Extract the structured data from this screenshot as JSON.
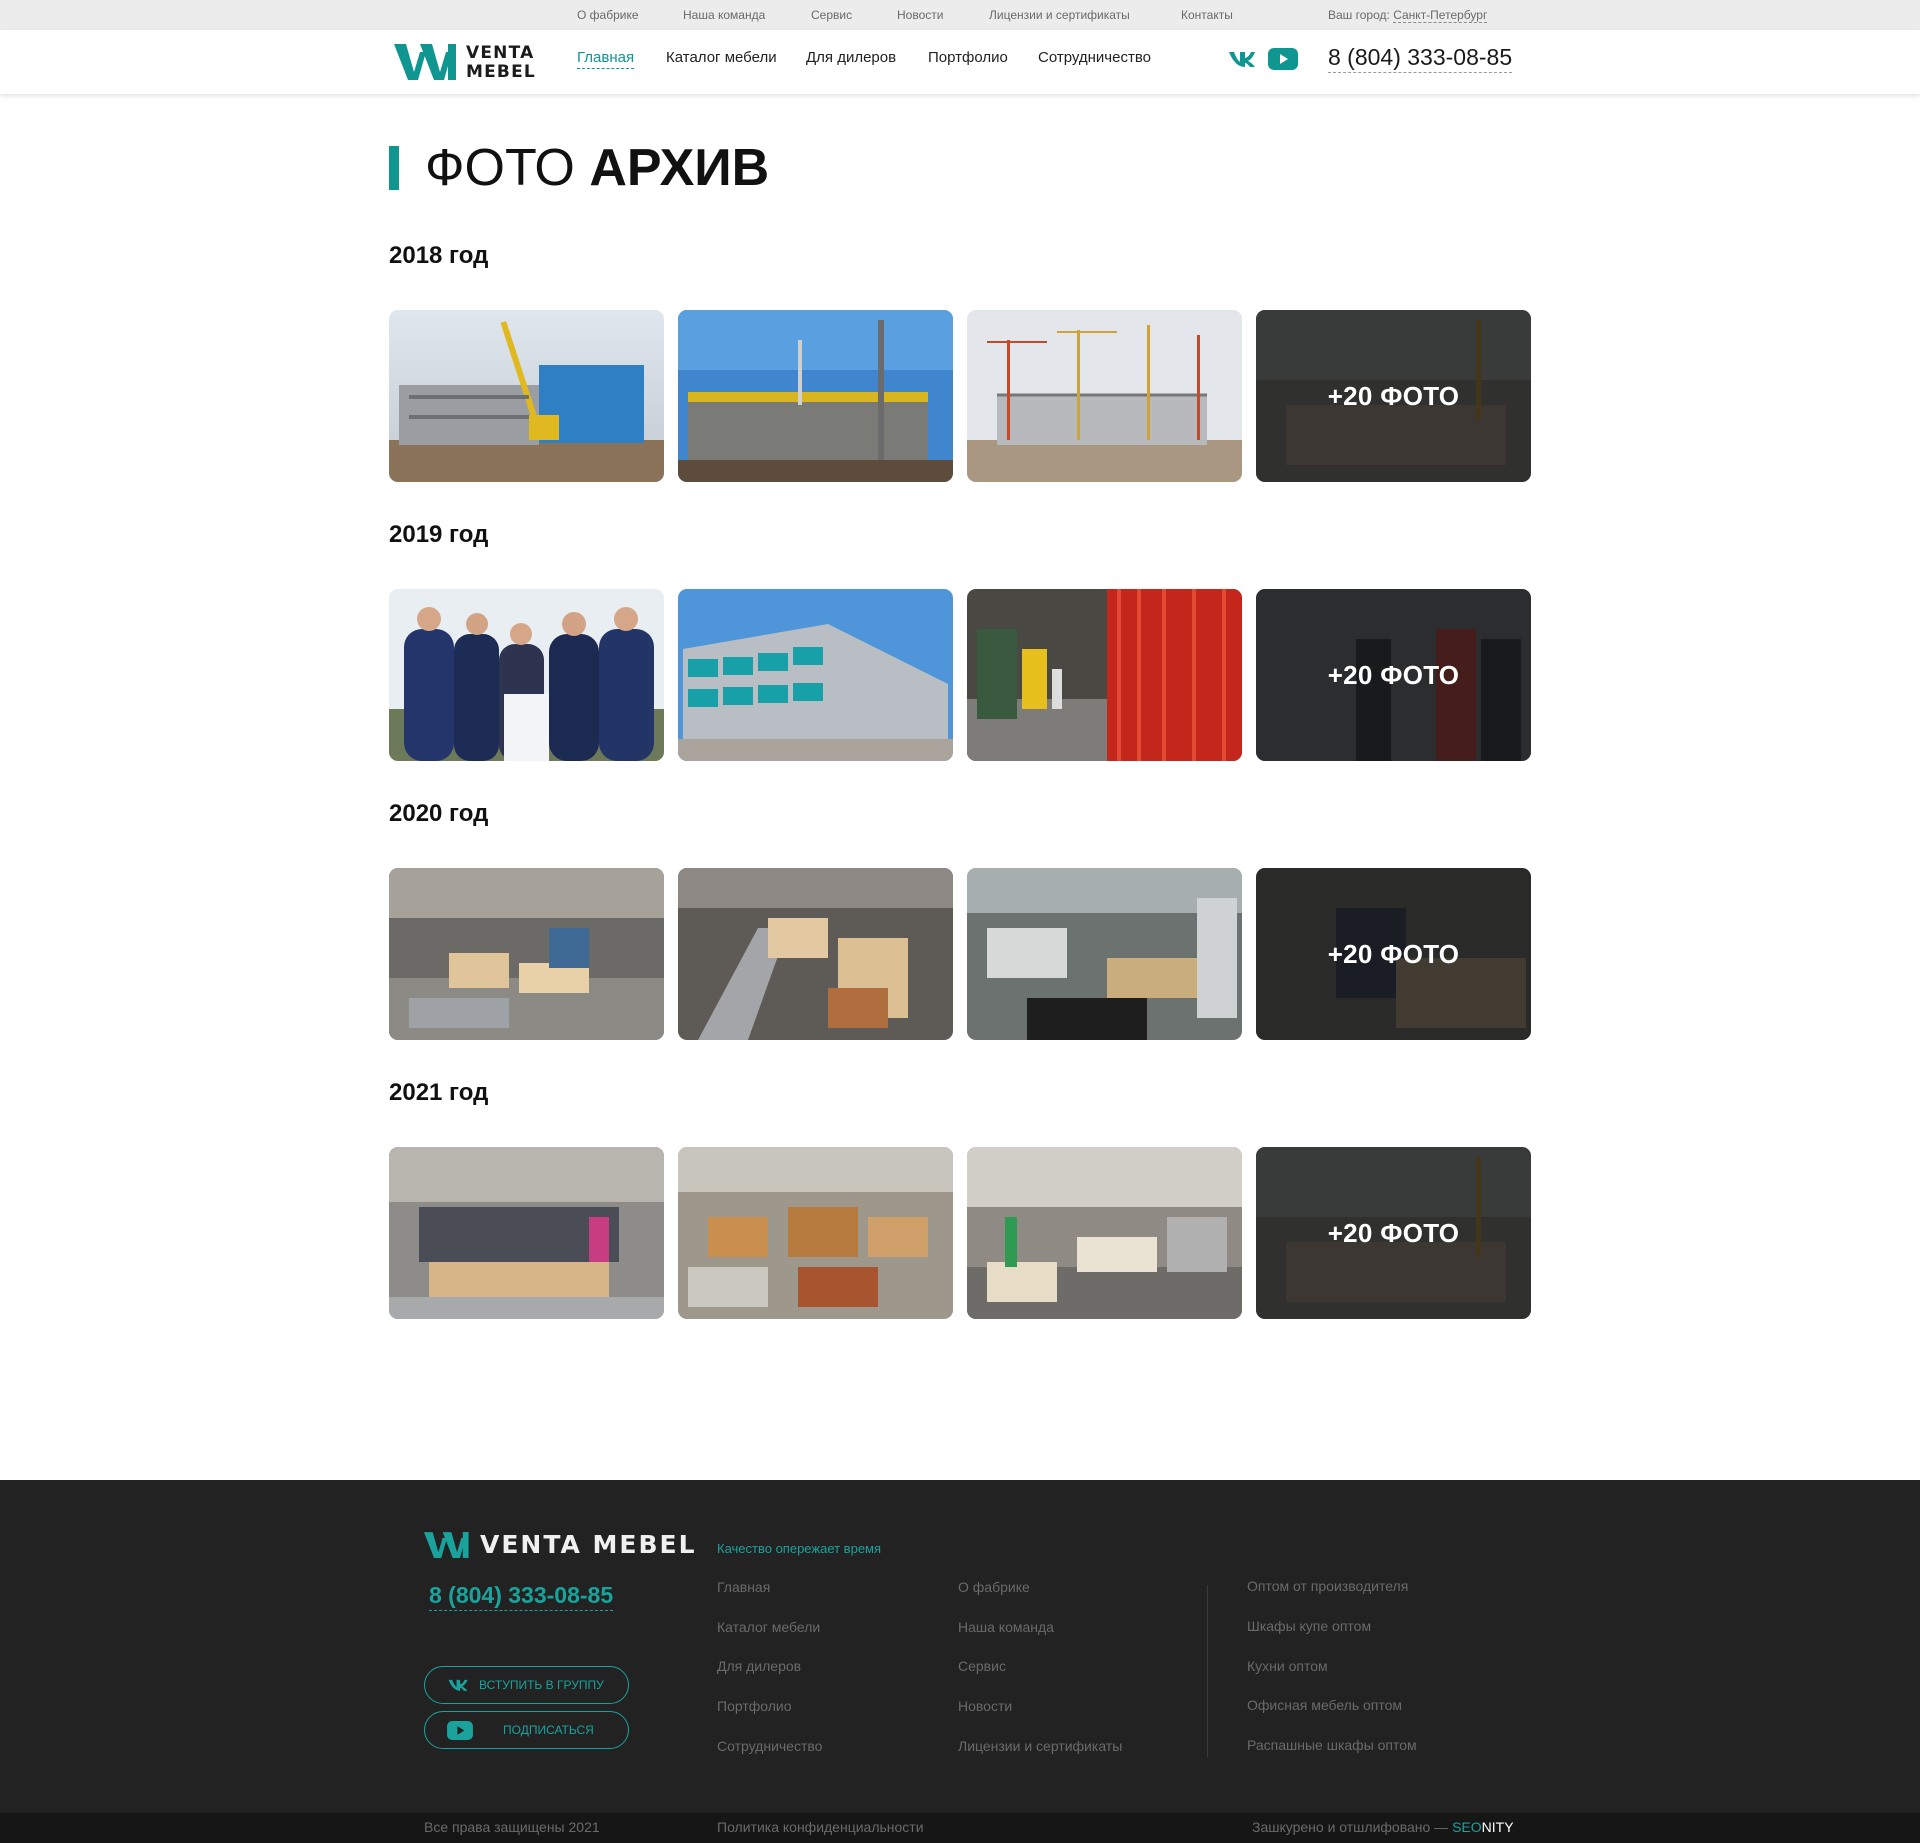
{
  "topbar": {
    "links": [
      "О фабрике",
      "Наша команда",
      "Сервис",
      "Новости",
      "Лицензии и сертификаты",
      "Контакты"
    ],
    "city_label": "Ваш город:",
    "city_value": "Санкт-Петербург"
  },
  "header": {
    "logo_line1": "VENTA",
    "logo_line2": "MEBEL",
    "nav": [
      "Главная",
      "Каталог мебели",
      "Для дилеров",
      "Портфолио",
      "Сотрудничество"
    ],
    "social_icons": [
      "vk-icon",
      "youtube-icon"
    ],
    "phone": "8 (804) 333-08-85"
  },
  "page": {
    "title_light": "ФОТО",
    "title_bold": "АРХИВ"
  },
  "gallery": [
    {
      "year": "2018 год",
      "more_label": "+20 ФОТО",
      "photos": [
        "construction-crane-blue-building",
        "construction-concrete-frame",
        "construction-cranes-steel-frame",
        "construction-site-overview"
      ]
    },
    {
      "year": "2019 год",
      "more_label": "+20 ФОТО",
      "photos": [
        "ceremony-officials-pressing-button",
        "factory-building-teal-panels",
        "factory-interior-red-curtains",
        "visitors-in-factory"
      ]
    },
    {
      "year": "2020 год",
      "more_label": "+20 ФОТО",
      "photos": [
        "production-line-panels",
        "conveyor-wood-panels",
        "cutting-machines-workers",
        "worker-at-machine"
      ]
    },
    {
      "year": "2021 год",
      "more_label": "+20 ФОТО",
      "photos": [
        "visitors-on-production-floor",
        "factory-hall-top-view",
        "factory-hall-worker-green",
        "construction-site-overview"
      ]
    }
  ],
  "footer": {
    "logo_text": "VENTA MEBEL",
    "tagline": "Качество опережает время",
    "phone": "8 (804) 333-08-85",
    "vk_button": "ВСТУПИТЬ В ГРУППУ",
    "youtube_button": "ПОДПИСАТЬСЯ",
    "col1": [
      "Главная",
      "Каталог мебели",
      "Для дилеров",
      "Портфолио",
      "Сотрудничество"
    ],
    "col2": [
      "О фабрике",
      "Наша команда",
      "Сервис",
      "Новости",
      "Лицензии и сертификаты"
    ],
    "col3": [
      "Оптом от производителя",
      "Шкафы купе оптом",
      "Кухни оптом",
      "Офисная мебель оптом",
      "Распашные шкафы оптом"
    ]
  },
  "bottombar": {
    "copyright": "Все права защищены 2021",
    "privacy": "Политика конфиденциальности",
    "credit_prefix": "Зашкурено и отшлифовано —",
    "credit_seo": "SEO",
    "credit_nity": "NITY"
  },
  "colors": {
    "accent": "#0f9690",
    "footer_bg": "#222222",
    "topbar_bg": "#ececec"
  }
}
